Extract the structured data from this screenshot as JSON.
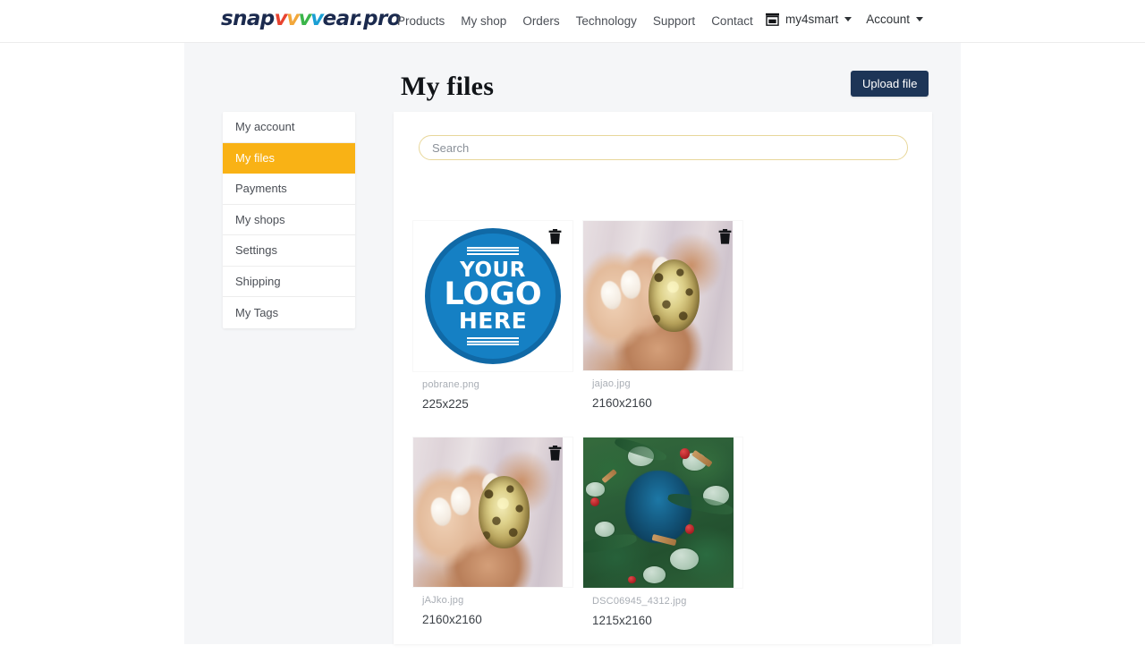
{
  "header": {
    "brand": {
      "pre": "snap",
      "w": "w",
      "post": "ear.pro"
    },
    "nav": [
      {
        "label": "Products"
      },
      {
        "label": "My shop"
      },
      {
        "label": "Orders"
      },
      {
        "label": "Technology"
      },
      {
        "label": "Support"
      },
      {
        "label": "Contact"
      }
    ],
    "shop_selector": {
      "label": "my4smart",
      "icon": "store-icon"
    },
    "account_selector": {
      "label": "Account",
      "icon": "chevron-down-icon"
    }
  },
  "main": {
    "title": "My files",
    "upload_button": "Upload file",
    "search": {
      "placeholder": "Search",
      "value": ""
    }
  },
  "sidebar": {
    "items": [
      {
        "label": "My account",
        "active": false
      },
      {
        "label": "My files",
        "active": true
      },
      {
        "label": "Payments",
        "active": false
      },
      {
        "label": "My shops",
        "active": false
      },
      {
        "label": "Settings",
        "active": false
      },
      {
        "label": "Shipping",
        "active": false
      },
      {
        "label": "My Tags",
        "active": false
      }
    ]
  },
  "files": [
    {
      "name": "pobrane.png",
      "dimensions": "225x225",
      "thumb": "logo-placeholder",
      "delete_icon": "trash-icon"
    },
    {
      "name": "jajao.jpg",
      "dimensions": "2160x2160",
      "thumb": "hand-holding-egg",
      "delete_icon": "trash-icon"
    },
    {
      "name": "jAJko.jpg",
      "dimensions": "2160x2160",
      "thumb": "hand-holding-egg",
      "delete_icon": "trash-icon"
    },
    {
      "name": "DSC06945_4312.jpg",
      "dimensions": "1215x2160",
      "thumb": "christmas-wreath",
      "delete_icon": "trash-icon"
    }
  ],
  "logo_thumb": {
    "line1": "YOUR",
    "line2": "LOGO",
    "line3": "HERE"
  },
  "colors": {
    "accent_orange": "#f9b215",
    "button_navy": "#1d3557",
    "page_bg": "#f5f6f8",
    "search_border": "#e8d79a",
    "logo_blue": "#1580c4"
  }
}
